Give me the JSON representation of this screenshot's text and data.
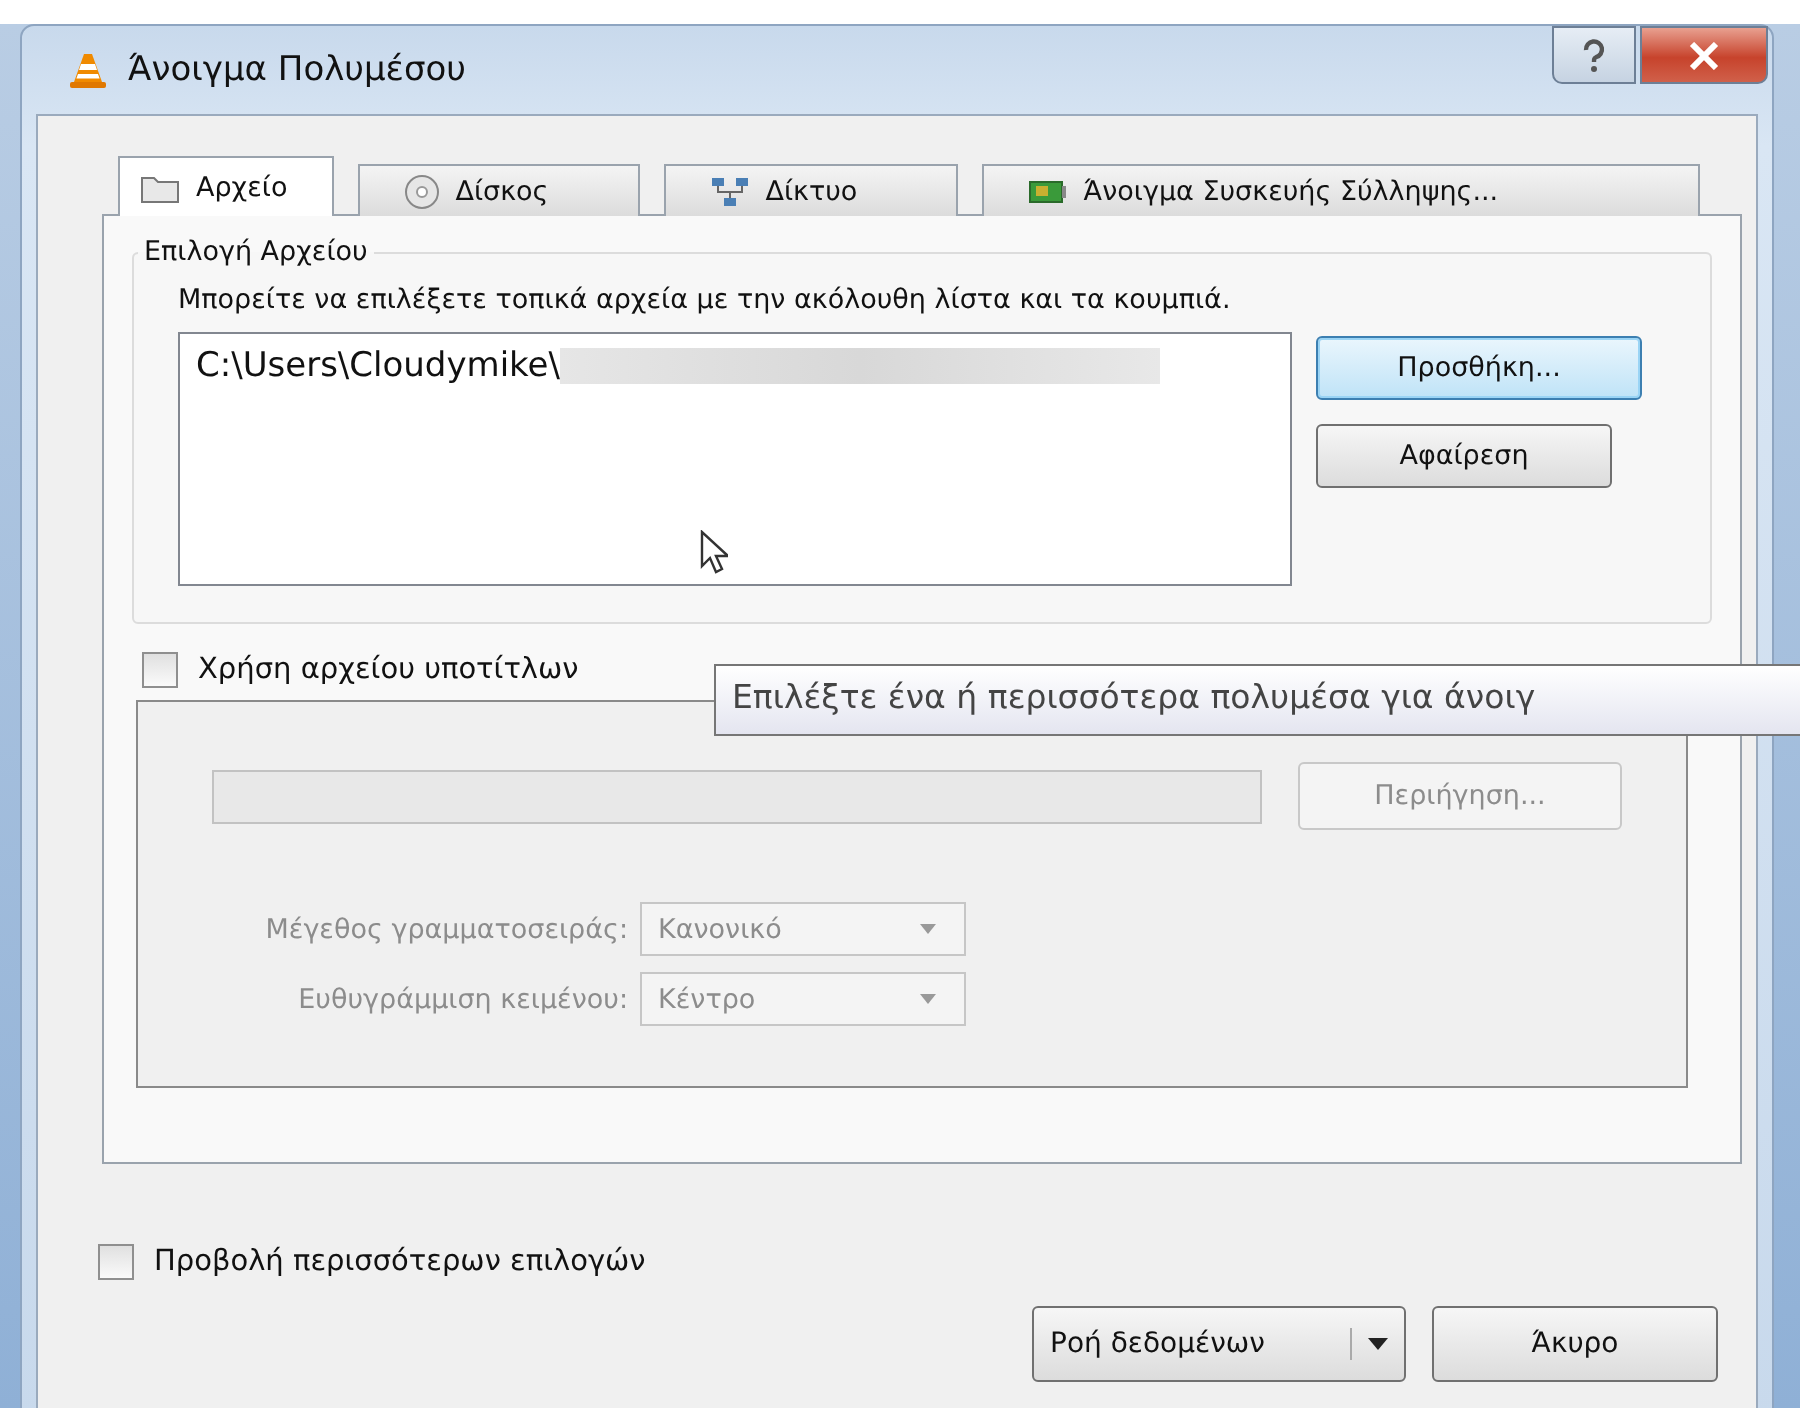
{
  "window": {
    "title": "Άνοιγμα Πολυμέσου"
  },
  "tabs": [
    {
      "label": "Αρχείο",
      "selected": true
    },
    {
      "label": "Δίσκος",
      "selected": false
    },
    {
      "label": "Δίκτυο",
      "selected": false
    },
    {
      "label": "Άνοιγμα Συσκευής Σύλληψης...",
      "selected": false
    }
  ],
  "file_group": {
    "title": "Επιλογή Αρχείου",
    "description": "Μπορείτε να επιλέξετε τοπικά αρχεία με την ακόλουθη λίστα και τα κουμπιά.",
    "files": [
      "C:\\Users\\Cloudymike\\"
    ],
    "buttons": [
      {
        "label": "Προσθήκη...",
        "focused": true
      },
      {
        "label": "Αφαίρεση",
        "focused": false
      }
    ]
  },
  "subtitles": {
    "label": "Χρήση αρχείου υποτίτλων",
    "checked": false,
    "disabled": true,
    "browse_button": "Περιήγηση...",
    "options": [
      {
        "label": "Μέγεθος γραμματοσειράς:",
        "value": "Κανονικό"
      },
      {
        "label": "Ευθυγράμμιση κειμένου:",
        "value": "Κέντρο"
      }
    ]
  },
  "tooltip": "Επιλέξτε ένα ή περισσότερα πολυμέσα για άνοιγ",
  "more_options": {
    "label": "Προβολή περισσότερων επιλογών",
    "checked": false
  },
  "buttons": {
    "stream": "Ροή δεδομένων",
    "cancel": "Άκυρο"
  }
}
